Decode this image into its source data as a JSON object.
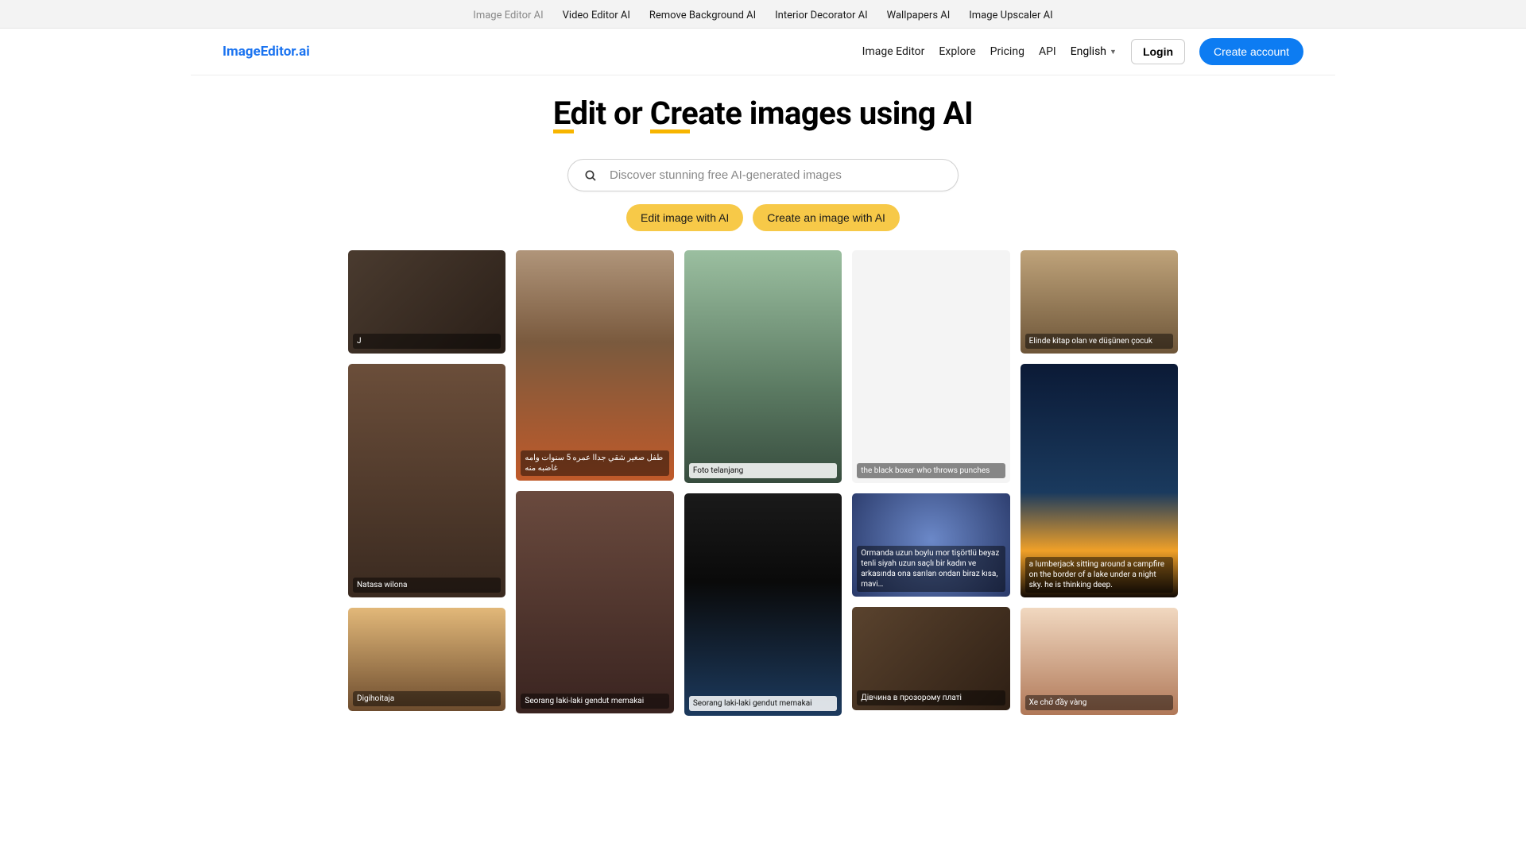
{
  "topbar": {
    "items": [
      {
        "label": "Image Editor AI",
        "active": true
      },
      {
        "label": "Video Editor AI"
      },
      {
        "label": "Remove Background AI"
      },
      {
        "label": "Interior Decorator AI"
      },
      {
        "label": "Wallpapers AI"
      },
      {
        "label": "Image Upscaler AI"
      }
    ]
  },
  "header": {
    "logo": "ImageEditor.ai",
    "nav": [
      "Image Editor",
      "Explore",
      "Pricing",
      "API"
    ],
    "language": "English",
    "login": "Login",
    "create_account": "Create account"
  },
  "hero": {
    "title_edit": "Edit",
    "title_mid": " or ",
    "title_create": "Create",
    "title_rest": " images using AI"
  },
  "search": {
    "placeholder": "Discover stunning free AI-generated images"
  },
  "pills": {
    "edit": "Edit image with AI",
    "create": "Create an image with AI"
  },
  "gallery": {
    "col0": [
      {
        "caption": "J"
      },
      {
        "caption": "Natasa wilona"
      },
      {
        "caption": "Digihoitaja"
      }
    ],
    "col1": [
      {
        "caption": "طفل صغير شقي جداا عمره 5 سنوات وامه غاضبه منه"
      },
      {
        "caption": "Seorang laki-laki gendut memakai"
      }
    ],
    "col2": [
      {
        "caption": "Foto telanjang"
      },
      {
        "caption": "Seorang laki-laki gendut memakai"
      }
    ],
    "col3": [
      {
        "caption": "the black boxer who throws punches"
      },
      {
        "caption": "Ormanda uzun boylu mor tişörtlü beyaz tenli siyah uzun saçlı bir kadın ve arkasında ona sarılan ondan biraz kısa, mavi…"
      },
      {
        "caption": "Дівчина в прозорому платі"
      }
    ],
    "col4": [
      {
        "caption": "Elinde kitap olan ve düşünen çocuk"
      },
      {
        "caption": "a lumberjack sitting around a campfire on the border of a lake under a night sky. he is thinking deep."
      },
      {
        "caption": "Xe chở đầy vàng"
      }
    ]
  }
}
